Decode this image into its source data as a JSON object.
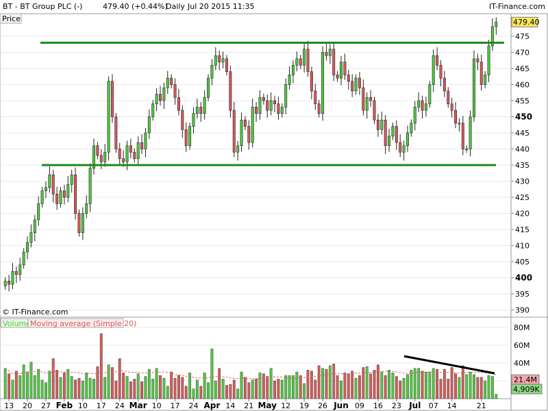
{
  "header": {
    "symbol": "BT - BT Group PLC (-)",
    "quote": "479.40 (+0.44%)",
    "period": "Daily",
    "datetime": "Jul 20 2015 11:35",
    "brand": "IT-Finance.com"
  },
  "price_panel": {
    "tab_label": "Price",
    "watermark": "© IT-Finance.com",
    "last_price_tag": "479.40"
  },
  "volume_panel": {
    "tab_volume": "Volume",
    "tab_ma": "Moving average (Simple 20)",
    "ma_tag": "21.4M",
    "volume_tag": "4,909K"
  },
  "colors": {
    "up": "#4fca3f",
    "down": "#d95a5a",
    "trendline": "#1a8a1a",
    "volume_trendline": "#000000",
    "moving_average": "#e06060",
    "last_price_tag_bg": "#ffe860",
    "ma_tag_bg": "#f3a9a9",
    "volume_tag_bg": "#8fdb82",
    "grid": "#e8e8e8"
  },
  "chart_data": [
    {
      "type": "candlestick",
      "title": "BT - BT Group PLC (-)",
      "ylabel": "Price",
      "ylim": [
        388,
        482
      ],
      "y_ticks": [
        390,
        395,
        400,
        405,
        410,
        415,
        420,
        425,
        430,
        435,
        440,
        445,
        450,
        455,
        460,
        465,
        470,
        475
      ],
      "y_ticks_bold": [
        400,
        450
      ],
      "x_tick_labels": [
        "13",
        "20",
        "27",
        "Feb",
        "10",
        "17",
        "24",
        "Mar",
        "10",
        "17",
        "24",
        "Apr",
        "14",
        "21",
        "May",
        "12",
        "19",
        "26",
        "Jun",
        "09",
        "16",
        "23",
        "Jul",
        "07",
        "14",
        "21"
      ],
      "x_ticks_bold": [
        "Feb",
        "Mar",
        "Apr",
        "May",
        "Jun",
        "Jul"
      ],
      "closes": [
        399,
        398,
        402,
        401,
        404,
        408,
        411,
        414,
        418,
        423,
        427,
        428,
        432,
        426,
        423,
        427,
        425,
        429,
        432,
        420,
        414,
        420,
        423,
        434,
        441,
        438,
        436,
        439,
        461,
        450,
        440,
        437,
        436,
        441,
        439,
        437,
        442,
        440,
        445,
        450,
        454,
        457,
        455,
        459,
        462,
        460,
        456,
        452,
        446,
        441,
        447,
        451,
        453,
        451,
        456,
        462,
        466,
        469,
        467,
        468,
        464,
        452,
        439,
        441,
        449,
        447,
        442,
        453,
        451,
        456,
        455,
        452,
        455,
        454,
        451,
        453,
        460,
        463,
        466,
        468,
        466,
        471,
        464,
        458,
        454,
        451,
        470,
        469,
        471,
        463,
        462,
        467,
        463,
        461,
        458,
        462,
        459,
        452,
        456,
        455,
        449,
        446,
        449,
        441,
        444,
        447,
        442,
        439,
        441,
        445,
        448,
        453,
        455,
        452,
        454,
        460,
        469,
        466,
        462,
        458,
        454,
        452,
        448,
        448,
        440,
        440,
        450,
        468,
        467,
        460,
        463,
        472,
        478,
        479.4
      ],
      "sma_line": "Moving average (Simple 20) on volume",
      "trendlines": [
        {
          "name": "resistance",
          "level": 473
        },
        {
          "name": "support",
          "level": 435
        }
      ]
    },
    {
      "type": "bar",
      "title": "Volume",
      "ylim": [
        0,
        80
      ],
      "unit": "M",
      "y_ticks": [
        "20M",
        "40M",
        "60M",
        "80M"
      ],
      "volumes": [
        34,
        28,
        21,
        31,
        26,
        38,
        30,
        41,
        26,
        33,
        21,
        18,
        31,
        45,
        32,
        24,
        29,
        33,
        25,
        21,
        23,
        20,
        29,
        23,
        22,
        36,
        73,
        24,
        38,
        35,
        20,
        45,
        29,
        25,
        19,
        22,
        28,
        19,
        25,
        33,
        22,
        34,
        26,
        23,
        14,
        30,
        23,
        26,
        24,
        14,
        29,
        11,
        21,
        14,
        29,
        18,
        56,
        20,
        34,
        22,
        15,
        16,
        21,
        11,
        30,
        24,
        18,
        21,
        22,
        29,
        28,
        25,
        34,
        20,
        22,
        21,
        26,
        26,
        26,
        30,
        26,
        17,
        32,
        31,
        21,
        37,
        34,
        33,
        37,
        39,
        26,
        20,
        29,
        28,
        31,
        23,
        26,
        35,
        36,
        28,
        32,
        38,
        30,
        26,
        32,
        29,
        25,
        20,
        23,
        27,
        32,
        34,
        34,
        31,
        30,
        30,
        34,
        33,
        22,
        33,
        22,
        35,
        28,
        24,
        37,
        27,
        30,
        27,
        24,
        24,
        20,
        26,
        25,
        4.9
      ],
      "moving_average_20_latest": 21.4,
      "downtrend_line": "declining volume trendline from mid-June to July"
    }
  ]
}
